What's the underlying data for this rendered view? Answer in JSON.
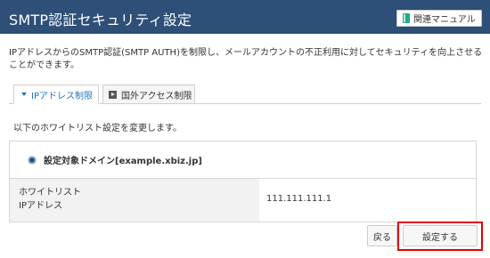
{
  "header": {
    "title": "SMTP認証セキュリティ設定",
    "manual_button": {
      "label": "関連マニュアル",
      "icon": "book-icon"
    }
  },
  "description": "IPアドレスからのSMTP認証(SMTP AUTH)を制限し、メールアカウントの不正利用に対してセキュリティを向上させることができます。",
  "tabs": [
    {
      "label": "IPアドレス制限",
      "active": true
    },
    {
      "label": "国外アクセス制限",
      "active": false
    }
  ],
  "subtext": "以下のホワイトリスト設定を変更します。",
  "settings": {
    "domain_label": "設定対象ドメイン[example.xbiz.jp]",
    "whitelist_label_line1": "ホワイトリスト",
    "whitelist_label_line2": "IPアドレス",
    "whitelist_value": "111.111.111.1"
  },
  "actions": {
    "back_label": "戻る",
    "submit_label": "設定する"
  },
  "colors": {
    "header_bg": "#2d4f78",
    "active_tab_text": "#1b78c2",
    "highlight": "#e60000"
  }
}
